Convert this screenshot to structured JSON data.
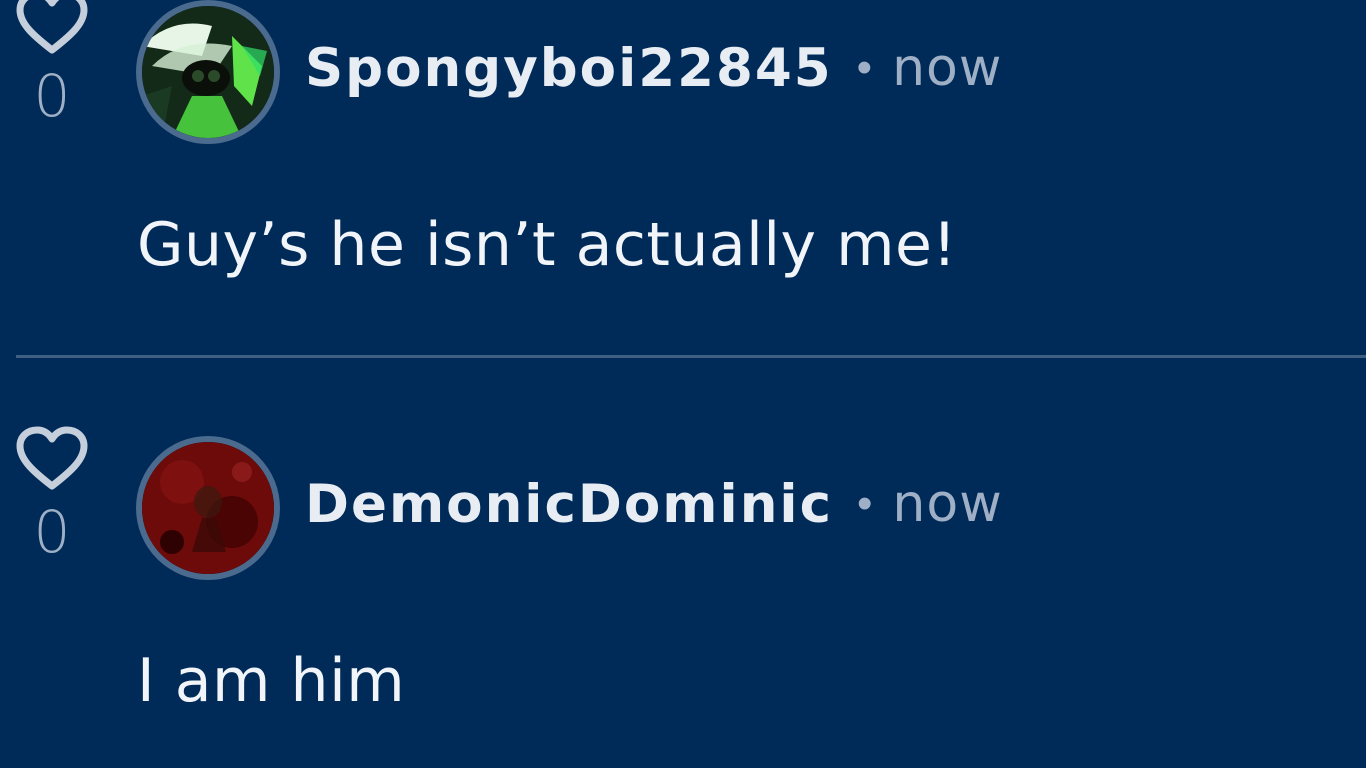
{
  "comments": [
    {
      "like_count": "0",
      "username": "Spongyboi22845",
      "separator": "•",
      "time": "now",
      "text": "Guy’s he isn’t actually me!",
      "avatar_icon": "green-character-avatar"
    },
    {
      "like_count": "0",
      "username": "DemonicDominic",
      "separator": "•",
      "time": "now",
      "text": "I am him",
      "avatar_icon": "dark-red-avatar"
    }
  ],
  "colors": {
    "background": "#002b59",
    "divider": "#3f5f82",
    "muted_text": "#9fb0c6",
    "primary_text": "#f1f4f8"
  }
}
